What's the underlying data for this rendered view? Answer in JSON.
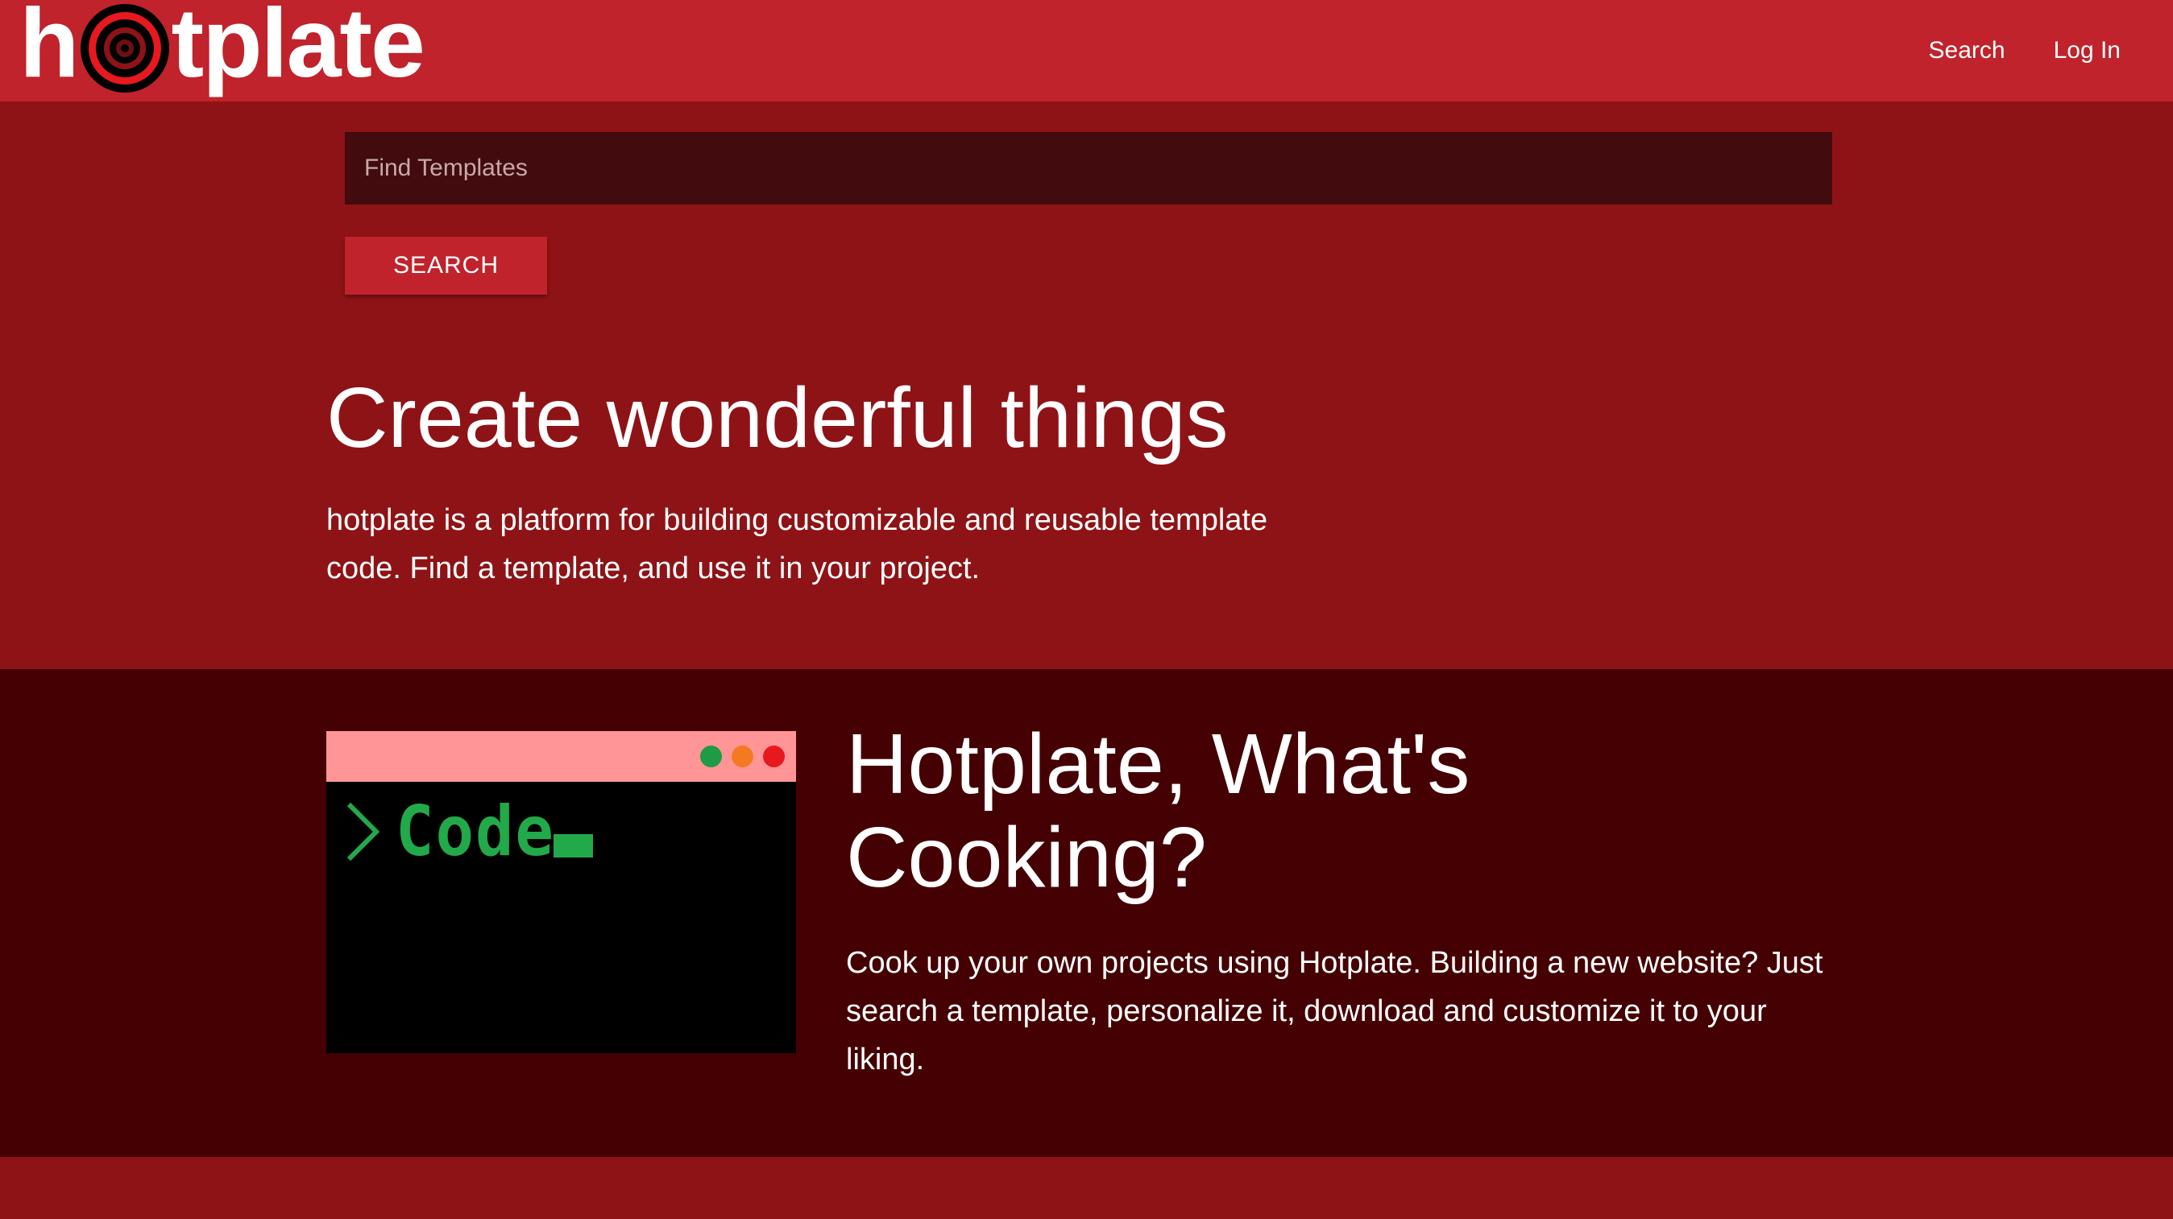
{
  "navbar": {
    "logo_left": "h",
    "logo_right": "tplate",
    "links": [
      {
        "label": "Search"
      },
      {
        "label": "Log In"
      }
    ]
  },
  "hero": {
    "search": {
      "placeholder": "Find Templates",
      "value": ""
    },
    "search_button_label": "SEARCH",
    "title": "Create wonderful things",
    "description": "hotplate is a platform for building customizable and reusable template code. Find a template, and use it in your project."
  },
  "cooking": {
    "code_window": {
      "code_text": "Code",
      "prompt_icon": "chevron-right-icon",
      "window_dots": [
        "#1f9a45",
        "#f47a22",
        "#e8181f"
      ]
    },
    "title": "Hotplate, What's Cooking?",
    "description": "Cook up your own projects using Hotplate. Building a new website? Just search a template, personalize it, download and customize it to your liking."
  },
  "colors": {
    "nav_background": "#c0232b",
    "hero_background": "#8e1316",
    "section_background": "#450004",
    "search_background": "#420b0d",
    "accent": "#c0232b",
    "code_green": "#22a94a",
    "titlebar_pink": "#ff9596"
  }
}
